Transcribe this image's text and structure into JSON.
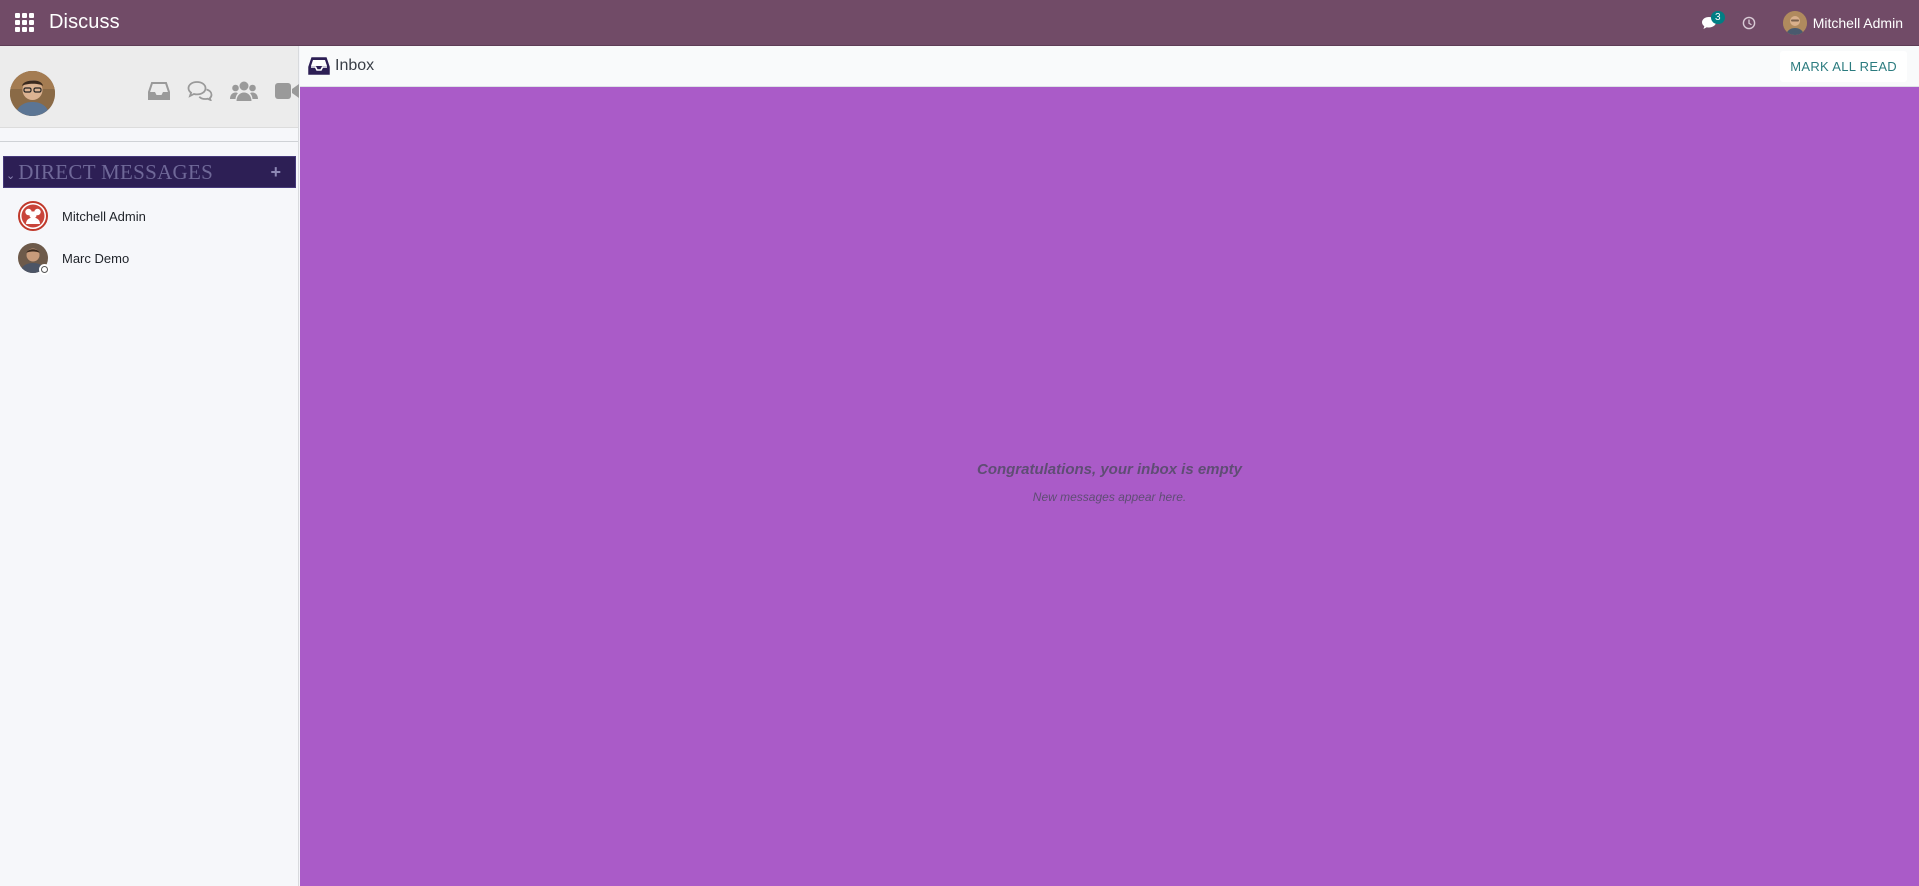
{
  "navbar": {
    "brand": "Discuss",
    "messages_badge": "3",
    "user_name": "Mitchell Admin",
    "bg_color": "#714b67"
  },
  "sidebar": {
    "icons": [
      "inbox-icon",
      "chat-bubbles-icon",
      "users-icon",
      "video-camera-icon"
    ],
    "section_title": "DIRECT MESSAGES",
    "section_add": "+",
    "direct_messages": [
      {
        "name": "Mitchell Admin",
        "status": "none"
      },
      {
        "name": "Marc Demo",
        "status": "offline"
      }
    ]
  },
  "main": {
    "title": "Inbox",
    "mark_all_read": "MARK ALL READ",
    "empty_title": "Congratulations, your inbox is empty",
    "empty_subtitle": "New messages appear here.",
    "area_color": "#aa5bc8"
  }
}
